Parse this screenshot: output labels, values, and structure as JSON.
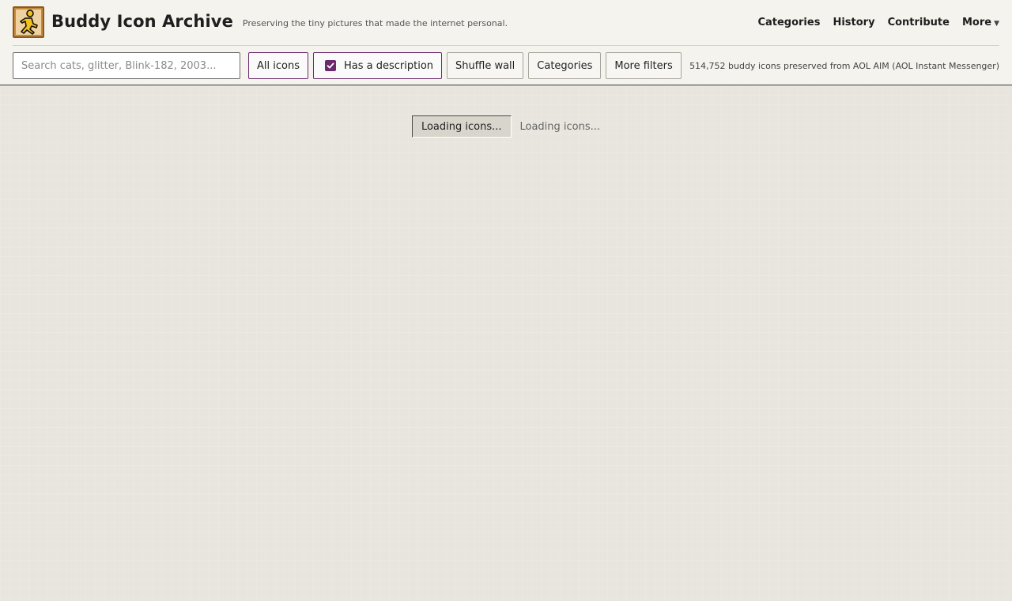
{
  "header": {
    "title": "Buddy Icon Archive",
    "tagline": "Preserving the tiny pictures that made the internet personal.",
    "logo_icon": "aim-running-man-icon",
    "nav": [
      {
        "label": "Categories"
      },
      {
        "label": "History"
      },
      {
        "label": "Contribute"
      },
      {
        "label": "More",
        "icon": "caret-down-icon"
      }
    ]
  },
  "toolbar": {
    "search_placeholder": "Search cats, glitter, Blink-182, 2003...",
    "search_value": "",
    "all_icons_label": "All icons",
    "has_description_label": "Has a description",
    "has_description_checked": true,
    "shuffle_label": "Shuffle wall",
    "categories_label": "Categories",
    "more_filters_label": "More filters",
    "stats": "514,752 buddy icons preserved from AOL AIM (AOL Instant Messenger)"
  },
  "main": {
    "loading_button": "Loading icons...",
    "loading_text": "Loading icons..."
  },
  "colors": {
    "accent": "#6c2a6e",
    "background": "#e8e5de",
    "header_bg": "#f5f3ee"
  }
}
